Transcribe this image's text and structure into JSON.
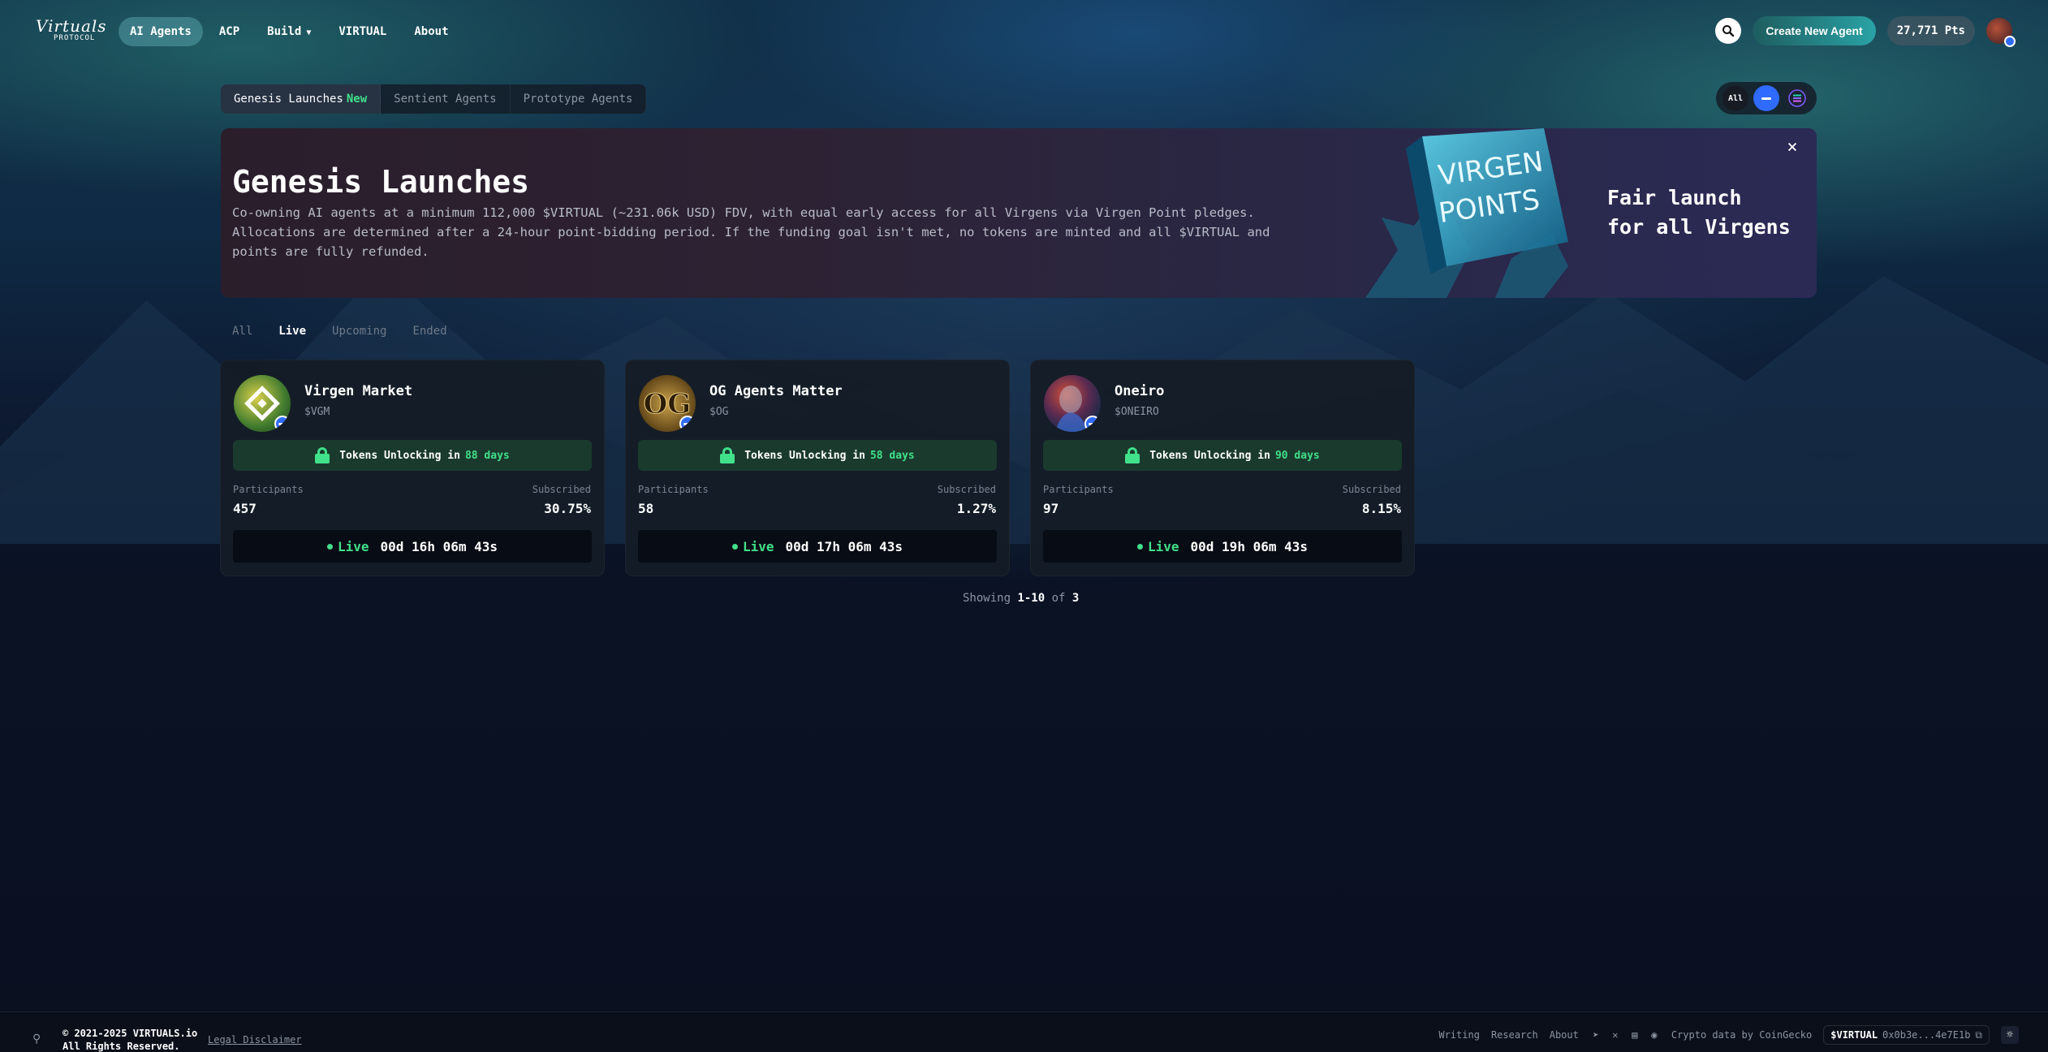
{
  "nav": {
    "logo_script": "Virtuals",
    "logo_sub": "PROTOCOL",
    "links": [
      "AI Agents",
      "ACP",
      "Build",
      "VIRTUAL",
      "About"
    ],
    "create_label": "Create New Agent",
    "points": "27,771 Pts"
  },
  "category_tabs": {
    "genesis": "Genesis Launches",
    "genesis_badge": "New",
    "sentient": "Sentient Agents",
    "prototype": "Prototype Agents"
  },
  "chain_filter": {
    "all": "All"
  },
  "banner": {
    "title": "Genesis Launches",
    "description": "Co-owning AI agents at a minimum 112,000 $VIRTUAL (~231.06k USD) FDV, with equal early access for all Virgens via Virgen Point pledges. Allocations are determined after a 24-hour point-bidding period. If the funding goal isn't met, no tokens are minted and all $VIRTUAL and points are fully refunded.",
    "art_line1": "VIRGEN",
    "art_line2": "POINTS",
    "tagline_1": "Fair launch",
    "tagline_2": "for all Virgens",
    "close": "×"
  },
  "filters": [
    "All",
    "Live",
    "Upcoming",
    "Ended"
  ],
  "cards": [
    {
      "name": "Virgen Market",
      "ticker": "$VGM",
      "unlock_prefix": "Tokens Unlocking in",
      "unlock_days": "88 days",
      "participants_label": "Participants",
      "participants": "457",
      "subscribed_label": "Subscribed",
      "subscribed": "30.75%",
      "status": "Live",
      "countdown": "00d 16h 06m 43s"
    },
    {
      "name": "OG Agents Matter",
      "ticker": "$OG",
      "icon_text": "OG",
      "unlock_prefix": "Tokens Unlocking in",
      "unlock_days": "58 days",
      "participants_label": "Participants",
      "participants": "58",
      "subscribed_label": "Subscribed",
      "subscribed": "1.27%",
      "status": "Live",
      "countdown": "00d 17h 06m 43s"
    },
    {
      "name": "Oneiro",
      "ticker": "$ONEIRO",
      "unlock_prefix": "Tokens Unlocking in",
      "unlock_days": "90 days",
      "participants_label": "Participants",
      "participants": "97",
      "subscribed_label": "Subscribed",
      "subscribed": "8.15%",
      "status": "Live",
      "countdown": "00d 19h 06m 43s"
    }
  ],
  "pagination": {
    "prefix": "Showing",
    "range": "1-10",
    "of": "of",
    "total": "3"
  },
  "footer": {
    "copyright_1": "© 2021-2025 VIRTUALS.io",
    "copyright_2": "All Rights Reserved.",
    "legal": "Legal Disclaimer",
    "links": [
      "Writing",
      "Research",
      "About"
    ],
    "coingecko": "Crypto data by CoinGecko",
    "token_symbol": "$VIRTUAL",
    "token_address": "0x0b3e...4e7E1b"
  },
  "colors": {
    "accent_green": "#41e08a",
    "base_blue": "#2f6bff",
    "create_gradient_end": "#2aa3a6"
  },
  "icons": [
    "search-icon",
    "chevron-down-icon",
    "close-icon",
    "lock-icon",
    "base-chain-icon",
    "solana-icon",
    "telegram-icon",
    "x-icon",
    "docs-icon",
    "coingecko-icon",
    "copy-icon",
    "sun-icon"
  ]
}
